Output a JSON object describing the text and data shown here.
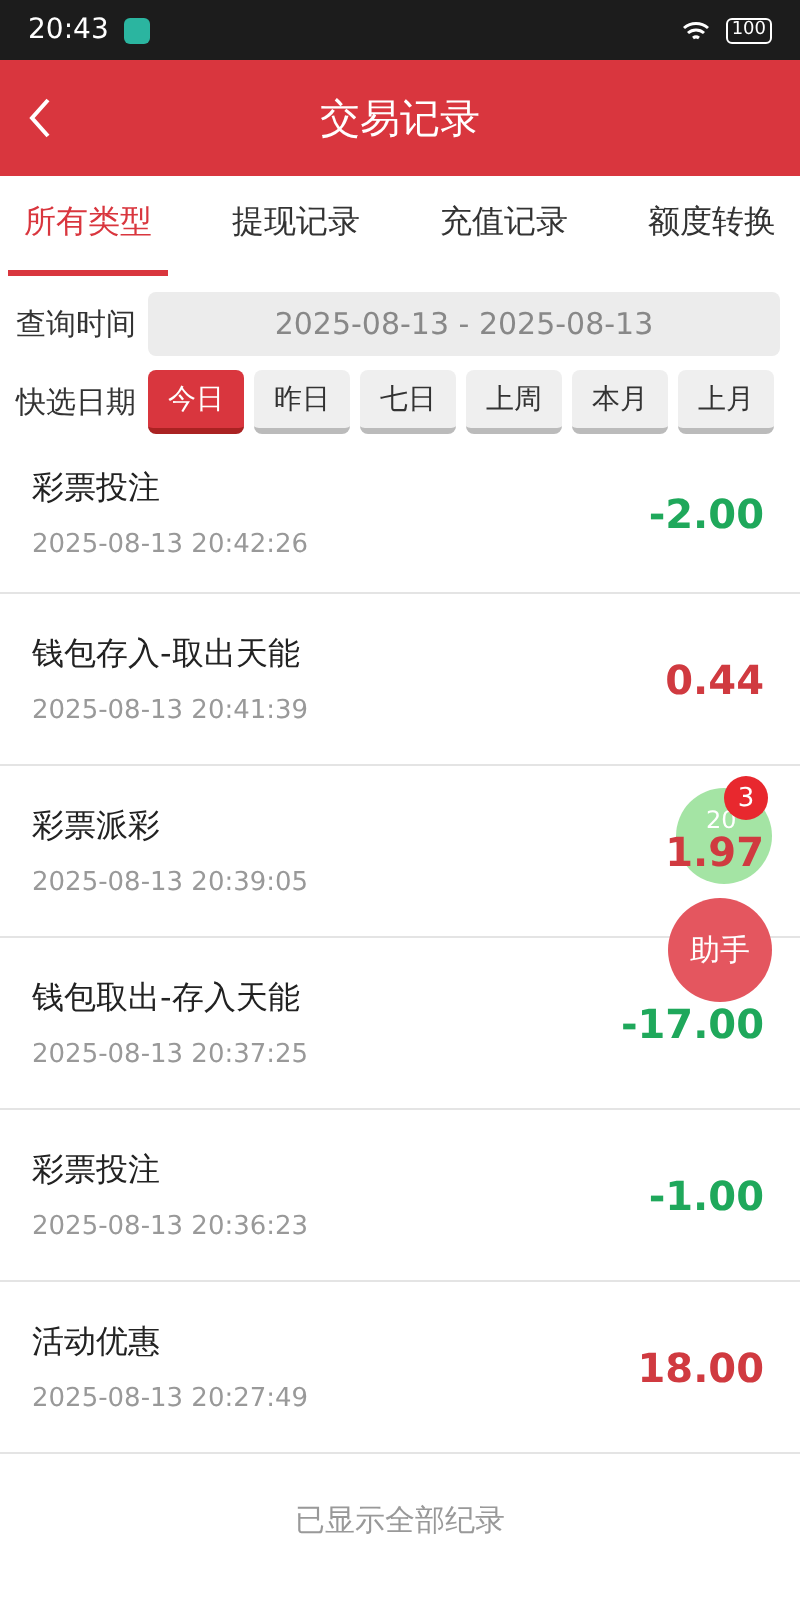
{
  "status_bar": {
    "time": "20:43",
    "battery": "100"
  },
  "header": {
    "title": "交易记录"
  },
  "tabs": [
    {
      "label": "所有类型",
      "selected": true
    },
    {
      "label": "提现记录",
      "selected": false
    },
    {
      "label": "充值记录",
      "selected": false
    },
    {
      "label": "额度转换",
      "selected": false
    }
  ],
  "query": {
    "label": "查询时间",
    "value": "2025-08-13 - 2025-08-13"
  },
  "quick_dates": {
    "label": "快选日期",
    "options": [
      {
        "label": "今日",
        "selected": true
      },
      {
        "label": "昨日",
        "selected": false
      },
      {
        "label": "七日",
        "selected": false
      },
      {
        "label": "上周",
        "selected": false
      },
      {
        "label": "本月",
        "selected": false
      },
      {
        "label": "上月",
        "selected": false
      }
    ]
  },
  "records": [
    {
      "title": "彩票投注",
      "time": "2025-08-13 20:42:26",
      "amount": "-2.00",
      "kind": "expense"
    },
    {
      "title": "钱包存入-取出天能",
      "time": "2025-08-13 20:41:39",
      "amount": "0.44",
      "kind": "income"
    },
    {
      "title": "彩票派彩",
      "time": "2025-08-13 20:39:05",
      "amount": "1.97",
      "kind": "income"
    },
    {
      "title": "钱包取出-存入天能",
      "time": "2025-08-13 20:37:25",
      "amount": "-17.00",
      "kind": "expense"
    },
    {
      "title": "彩票投注",
      "time": "2025-08-13 20:36:23",
      "amount": "-1.00",
      "kind": "expense"
    },
    {
      "title": "活动优惠",
      "time": "2025-08-13 20:27:49",
      "amount": "18.00",
      "kind": "income"
    }
  ],
  "footer": "已显示全部纪录",
  "floating": {
    "counter": "20",
    "badge": "3",
    "assistant": "助手"
  }
}
